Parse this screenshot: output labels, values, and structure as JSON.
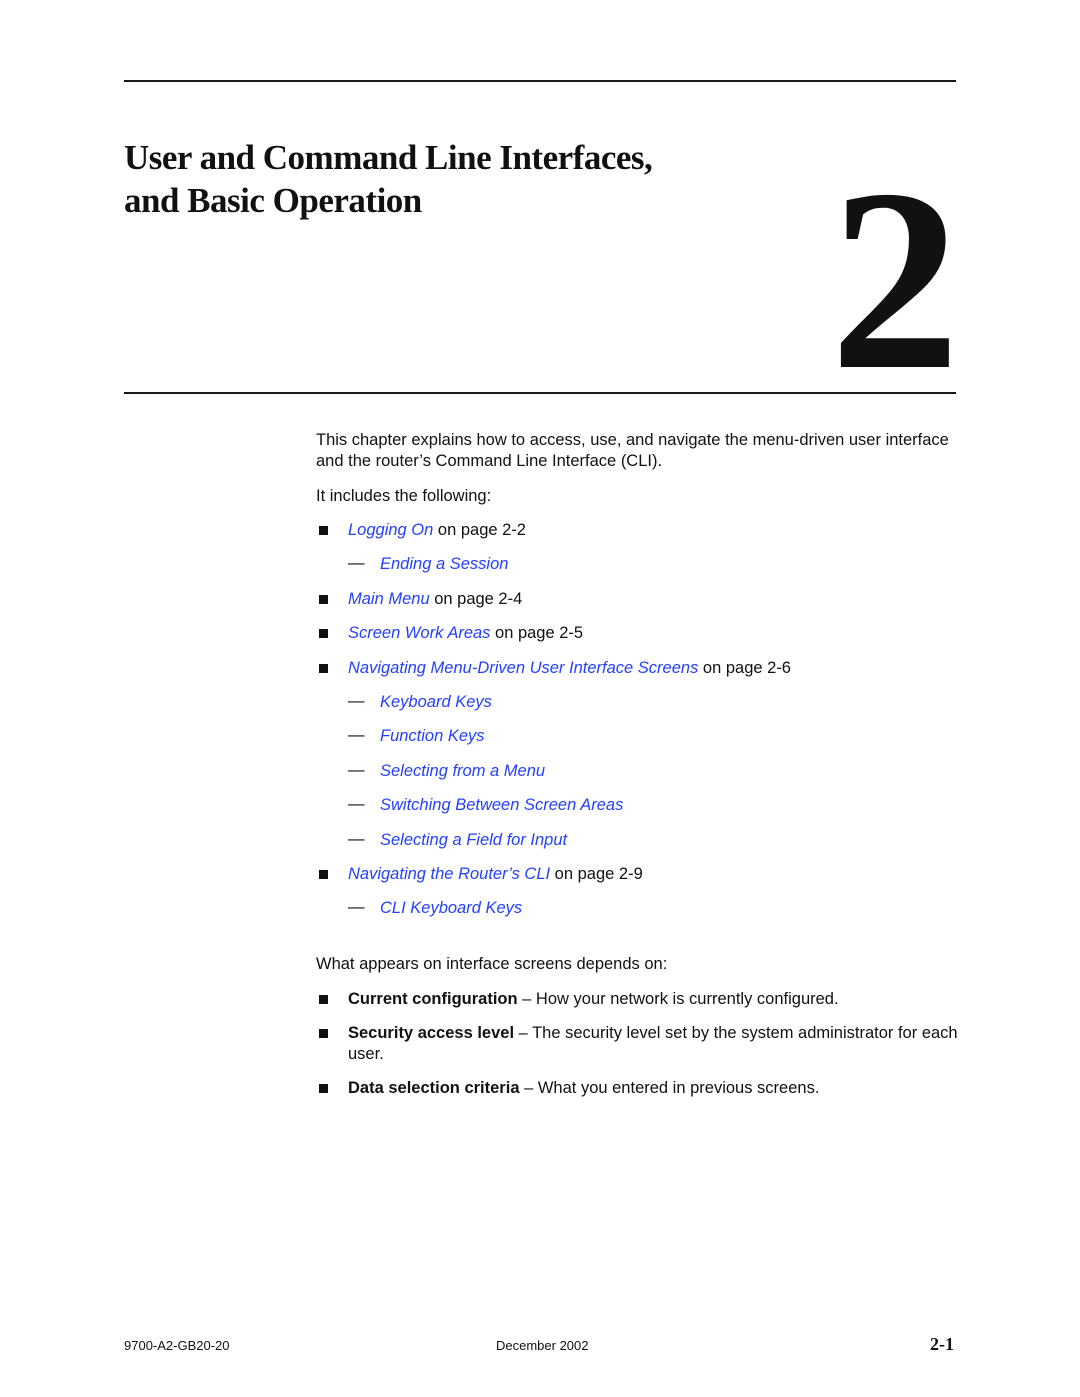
{
  "chapter": {
    "title_line1": "User and Command Line Interfaces,",
    "title_line2": "and Basic Operation",
    "number": "2"
  },
  "intro": {
    "paragraph": "This chapter explains how to access, use, and navigate the menu-driven user interface and the router’s Command Line Interface (CLI).",
    "includes_label": "It includes the following:"
  },
  "toc": [
    {
      "level": 1,
      "link": "Logging On",
      "suffix": " on page 2-2"
    },
    {
      "level": 2,
      "link": "Ending a Session",
      "suffix": ""
    },
    {
      "level": 1,
      "link": "Main Menu",
      "suffix": " on page 2-4"
    },
    {
      "level": 1,
      "link": "Screen Work Areas",
      "suffix": " on page 2-5"
    },
    {
      "level": 1,
      "link": "Navigating Menu-Driven User Interface Screens",
      "suffix": " on page 2-6"
    },
    {
      "level": 2,
      "link": "Keyboard Keys",
      "suffix": ""
    },
    {
      "level": 2,
      "link": "Function Keys",
      "suffix": ""
    },
    {
      "level": 2,
      "link": "Selecting from a Menu",
      "suffix": ""
    },
    {
      "level": 2,
      "link": "Switching Between Screen Areas",
      "suffix": ""
    },
    {
      "level": 2,
      "link": "Selecting a Field for Input",
      "suffix": ""
    },
    {
      "level": 1,
      "link": "Navigating the Router’s CLI",
      "suffix": " on page 2-9"
    },
    {
      "level": 2,
      "link": "CLI Keyboard Keys",
      "suffix": ""
    }
  ],
  "dash_glyph": "—",
  "depends": {
    "lead": "What appears on interface screens depends on:",
    "items": [
      {
        "term": "Current configuration",
        "desc": " – How your network is currently configured."
      },
      {
        "term": "Security access level",
        "desc": " – The security level set by the system administrator for each user."
      },
      {
        "term": "Data selection criteria",
        "desc": " – What you entered in previous screens."
      }
    ]
  },
  "footer": {
    "doc_number": "9700-A2-GB20-20",
    "date": "December 2002",
    "page": "2-1"
  },
  "colors": {
    "link": "#2440ff",
    "text": "#111111",
    "rule": "#1a1a1a"
  }
}
